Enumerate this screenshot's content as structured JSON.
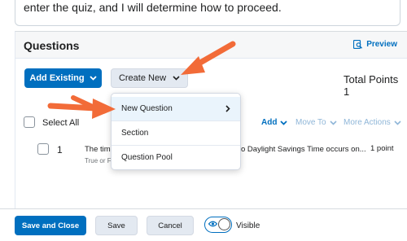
{
  "instructions": {
    "text": "enter the quiz, and I will determine how to proceed."
  },
  "questions": {
    "title": "Questions",
    "preview_label": "Preview",
    "add_existing_label": "Add Existing",
    "create_new_label": "Create New",
    "total_points_label": "Total Points 1",
    "select_all_label": "Select All",
    "actions": {
      "add_label": "Add",
      "move_to_label": "Move To",
      "more_actions_label": "More Actions"
    },
    "rows": [
      {
        "number": "1",
        "text_visible": "The tim",
        "text_right": "o Daylight Savings Time occurs on...",
        "type_visible": "True or F",
        "points": "1 point"
      }
    ]
  },
  "create_new_menu": {
    "items": [
      {
        "label": "New Question",
        "has_submenu": true,
        "highlighted": true
      },
      {
        "label": "Section",
        "has_submenu": false,
        "highlighted": false
      },
      {
        "label": "Question Pool",
        "has_submenu": false,
        "highlighted": false
      }
    ]
  },
  "footer": {
    "save_close_label": "Save and Close",
    "save_label": "Save",
    "cancel_label": "Cancel",
    "visible_label": "Visible",
    "visible_on": true
  },
  "colors": {
    "primary": "#006fbf",
    "secondary_bg": "#e3e9f1",
    "annotation_arrow": "#f26b38",
    "menu_highlight": "#eaf4fc"
  },
  "icons": {
    "preview": "preview-icon",
    "chevron": "chevron-down-icon",
    "submenu": "chevron-right-icon",
    "eye": "eye-icon",
    "arrow": "annotation-arrow-icon"
  }
}
